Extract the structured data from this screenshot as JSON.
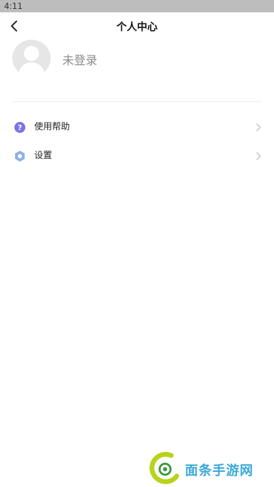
{
  "status_bar": {
    "time": "4:11"
  },
  "header": {
    "title": "个人中心",
    "back_icon": "chevron-left-icon"
  },
  "profile": {
    "avatar_icon": "default-avatar-icon",
    "login_label": "未登录"
  },
  "menu": {
    "items": [
      {
        "label": "使用帮助",
        "icon": "help-icon",
        "icon_color": "#7c73e6"
      },
      {
        "label": "设置",
        "icon": "settings-icon",
        "icon_color": "#8fb1e8"
      }
    ]
  },
  "watermark": {
    "text": "面条手游网",
    "color": "#3aa8d8",
    "logo_color": "#b8d31a"
  }
}
